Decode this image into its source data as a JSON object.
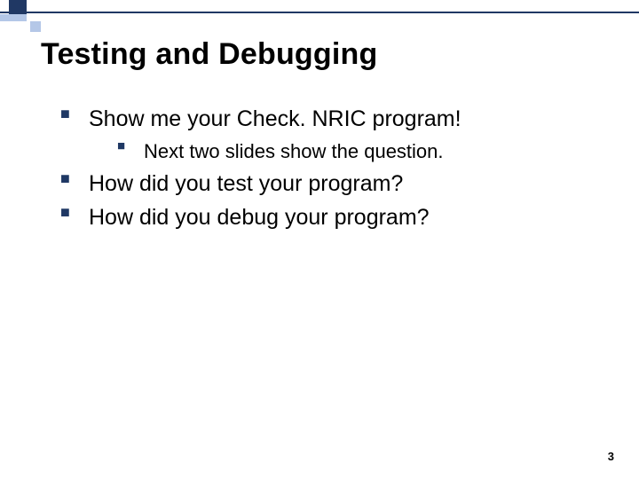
{
  "title": "Testing and Debugging",
  "bullets": {
    "b1": "Show me your Check. NRIC program!",
    "b1a": "Next two slides show the question.",
    "b2": "How did you test your program?",
    "b3": "How did you debug your program?"
  },
  "page_number": "3",
  "colors": {
    "accent_dark": "#203864",
    "accent_light": "#b4c7e7"
  }
}
